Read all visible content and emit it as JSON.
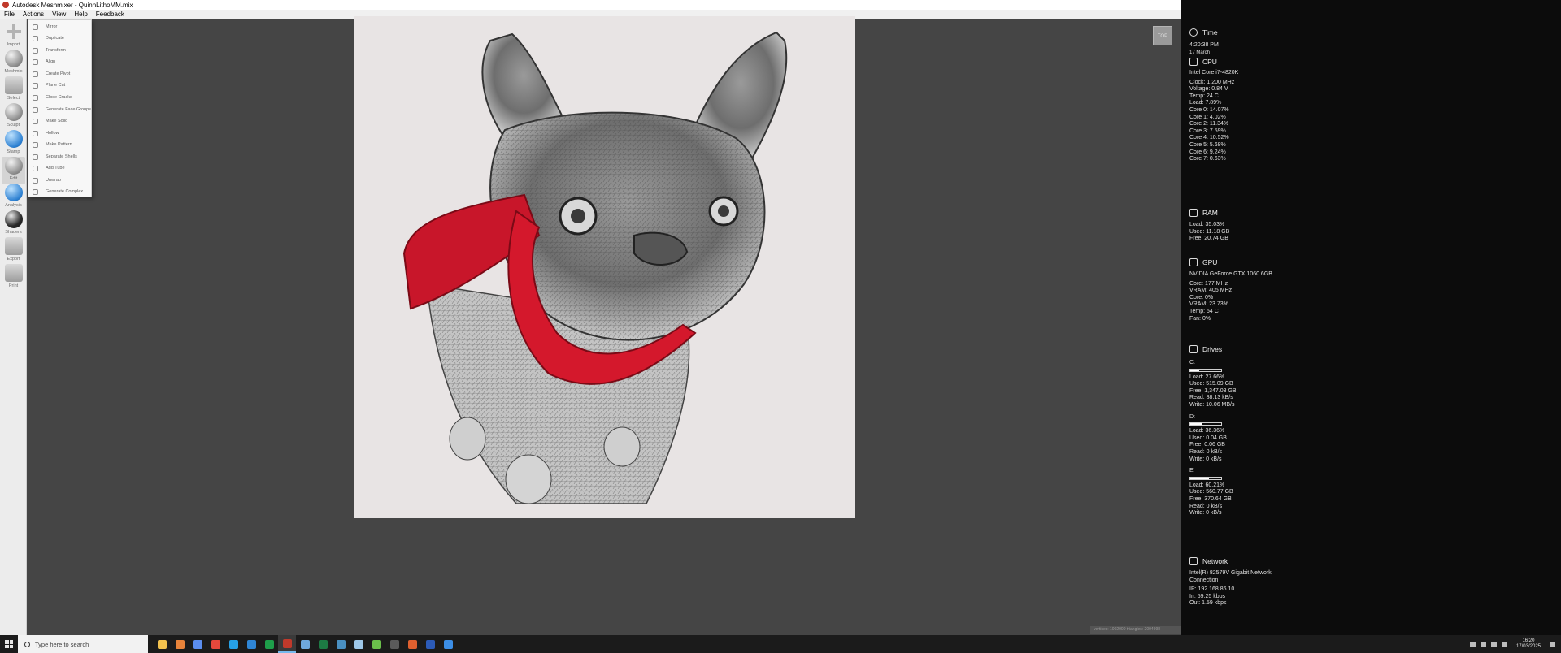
{
  "window": {
    "title": "Autodesk Meshmixer - QuinnLithoMM.mix"
  },
  "menu": [
    "File",
    "Actions",
    "View",
    "Help",
    "Feedback"
  ],
  "toolbar": [
    {
      "label": "Import",
      "icon": "plus-icon"
    },
    {
      "label": "Meshmix",
      "icon": "meshmix-icon"
    },
    {
      "label": "Select",
      "icon": "select-icon"
    },
    {
      "label": "Sculpt",
      "icon": "sculpt-icon"
    },
    {
      "label": "Stamp",
      "icon": "stamp-icon"
    },
    {
      "label": "Edit",
      "icon": "edit-icon"
    },
    {
      "label": "Analysis",
      "icon": "analysis-icon"
    },
    {
      "label": "Shaders",
      "icon": "shaders-icon"
    },
    {
      "label": "Export",
      "icon": "export-icon"
    },
    {
      "label": "Print",
      "icon": "print-icon"
    }
  ],
  "edit_menu": [
    "Mirror",
    "Duplicate",
    "Transform",
    "Align",
    "Create Pivot",
    "Plane Cut",
    "Close Cracks",
    "Generate Face Groups",
    "Make Solid",
    "Hollow",
    "Make Pattern",
    "Separate Shells",
    "Add Tube",
    "Unwrap",
    "Generate Complex"
  ],
  "viewport": {
    "view_cube": "TOP",
    "stats": "vertices: 1002000 triangles: 2004998"
  },
  "sidebar": {
    "time": {
      "title": "Time",
      "clock": "4:20:38 PM",
      "date": "17 March"
    },
    "cpu": {
      "title": "CPU",
      "lines": [
        "Intel Core i7-4820K",
        "Clock: 1,200 MHz",
        "Voltage: 0.84 V",
        "Temp: 24 C",
        "Load: 7.89%",
        "Core 0: 14.07%",
        "Core 1: 4.02%",
        "Core 2: 11.34%",
        "Core 3: 7.59%",
        "Core 4: 10.52%",
        "Core 5: 5.68%",
        "Core 6: 9.24%",
        "Core 7: 0.63%"
      ]
    },
    "ram": {
      "title": "RAM",
      "lines": [
        "Load: 35.03%",
        "Used: 11.18 GB",
        "Free: 20.74 GB"
      ]
    },
    "gpu": {
      "title": "GPU",
      "lines": [
        "NVIDIA GeForce GTX 1060 6GB",
        "Core: 177 MHz",
        "VRAM: 405 MHz",
        "Core: 0%",
        "VRAM: 23.73%",
        "Temp: 54 C",
        "Fan: 0%"
      ]
    },
    "drives": {
      "title": "Drives",
      "items": [
        {
          "name": "C:",
          "load_pct": 27.66,
          "lines": [
            "Load: 27.66%",
            "Used: 515.09 GB",
            "Free: 1,347.03 GB",
            "Read: 88.13 kB/s",
            "Write: 10.06 MB/s"
          ]
        },
        {
          "name": "D:",
          "load_pct": 36.36,
          "lines": [
            "Load: 36.36%",
            "Used: 0.04 GB",
            "Free: 0.06 GB",
            "Read: 0 kB/s",
            "Write: 0 kB/s"
          ]
        },
        {
          "name": "E:",
          "load_pct": 60.21,
          "lines": [
            "Load: 60.21%",
            "Used: 560.77 GB",
            "Free: 370.64 GB",
            "Read: 0 kB/s",
            "Write: 0 kB/s"
          ]
        }
      ]
    },
    "network": {
      "title": "Network",
      "lines": [
        "Intel(R) 82579V Gigabit Network",
        "Connection",
        "IP: 192.168.86.10",
        "In: 59.25 kbps",
        "Out: 1.59 kbps"
      ]
    }
  },
  "taskbar": {
    "search_placeholder": "Type here to search",
    "time": "16:20",
    "date": "17/03/2025",
    "apps": [
      {
        "name": "file-explorer",
        "color": "#f2c14e"
      },
      {
        "name": "mail",
        "color": "#e8833a"
      },
      {
        "name": "app-3",
        "color": "#5b8def"
      },
      {
        "name": "chrome",
        "color": "#e5483c"
      },
      {
        "name": "skype",
        "color": "#26a0e6"
      },
      {
        "name": "app-6",
        "color": "#2f86d6"
      },
      {
        "name": "excel-x",
        "color": "#1e9e4a"
      },
      {
        "name": "meshmixer",
        "color": "#c0392b"
      },
      {
        "name": "app-9",
        "color": "#6fa8dc"
      },
      {
        "name": "excel",
        "color": "#1d7a44"
      },
      {
        "name": "app-11",
        "color": "#4a90c2"
      },
      {
        "name": "app-12",
        "color": "#9ec7e8"
      },
      {
        "name": "app-13",
        "color": "#6abf4b"
      },
      {
        "name": "app-14",
        "color": "#5a5a5a"
      },
      {
        "name": "app-15",
        "color": "#e0602f"
      },
      {
        "name": "app-16",
        "color": "#2c5bb8"
      },
      {
        "name": "app-17",
        "color": "#3c8ee6"
      }
    ]
  }
}
